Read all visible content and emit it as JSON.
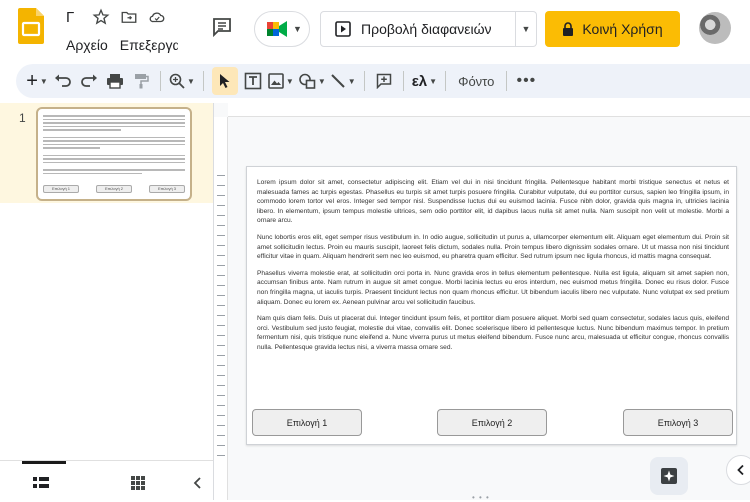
{
  "header": {
    "menu": [
      "Αρχείο",
      "Επεξεργασία"
    ],
    "slideshow_label": "Προβολή διαφανειών",
    "share_label": "Κοινή Χρήση"
  },
  "toolbar": {
    "input_tools_label": "ελ",
    "font_label": "Φόντο"
  },
  "filmstrip": {
    "slide_number": "1",
    "thumb_buttons": [
      "Επιλογή 1",
      "Επιλογή 2",
      "Επιλογή 3"
    ]
  },
  "slide": {
    "paragraphs": [
      "Lorem ipsum dolor sit amet, consectetur adipiscing elit. Etiam vel dui in nisi tincidunt fringilla. Pellentesque habitant morbi tristique senectus et netus et malesuada fames ac turpis egestas. Phasellus eu turpis sit amet turpis posuere fringilla. Curabitur vulputate, dui eu porttitor cursus, sapien leo fringilla ipsum, in commodo lorem tortor vel eros. Integer sed tempor nisl. Suspendisse luctus dui eu euismod lacinia. Fusce nibh dolor, gravida quis magna in, ultricies lacinia libero. In elementum, ipsum tempus molestie ultrices, sem odio porttitor elit, id dapibus lacus nulla sit amet nulla. Nam suscipit non velit ut molestie. Morbi a ornare arcu.",
      "Nunc lobortis eros elit, eget semper risus vestibulum in. In odio augue, sollicitudin ut purus a, ullamcorper elementum elit. Aliquam eget elementum dui. Proin sit amet sollicitudin lectus. Proin eu mauris suscipit, laoreet felis dictum, sodales nulla. Proin tempus libero dignissim sodales ornare. Ut ut massa non nisi tincidunt efficitur vitae in quam. Aliquam hendrerit sem nec leo euismod, eu pharetra quam efficitur. Sed rutrum ipsum nec ligula rhoncus, id mattis magna consequat.",
      "Phasellus viverra molestie erat, at sollicitudin orci porta in. Nunc gravida eros in tellus elementum pellentesque. Nulla est ligula, aliquam sit amet sapien non, accumsan finibus ante. Nam rutrum in augue sit amet congue. Morbi lacinia lectus eu eros interdum, nec euismod metus fringilla. Donec eu risus dolor. Fusce non fringilla magna, ut iaculis turpis. Praesent tincidunt lectus non quam rhoncus efficitur. Ut bibendum iaculis libero nec vulputate. Nunc volutpat ex sed pretium aliquam. Donec eu lorem ex. Aenean pulvinar arcu vel sollicitudin faucibus.",
      "Nam quis diam felis. Duis ut placerat dui. Integer tincidunt ipsum felis, et porttitor diam posuere aliquet. Morbi sed quam consectetur, sodales lacus quis, eleifend orci. Vestibulum sed justo feugiat, molestie dui vitae, convallis elit. Donec scelerisque libero id pellentesque luctus. Nunc bibendum maximus tempor. In pretium fermentum nisi, quis tristique nunc eleifend a. Nunc viverra purus ut metus eleifend bibendum. Fusce nunc arcu, malesuada ut efficitur congue, rhoncus convallis nulla. Pellentesque gravida lectus nisi, a viverra massa ornare sed."
    ],
    "buttons": [
      "Επιλογή 1",
      "Επιλογή 2",
      "Επιλογή 3"
    ]
  },
  "colors": {
    "share": "#fbbc04",
    "toolbar_bg": "#eef2f9",
    "selected_tool": "#fde7b8",
    "logo": "#f4b400"
  }
}
